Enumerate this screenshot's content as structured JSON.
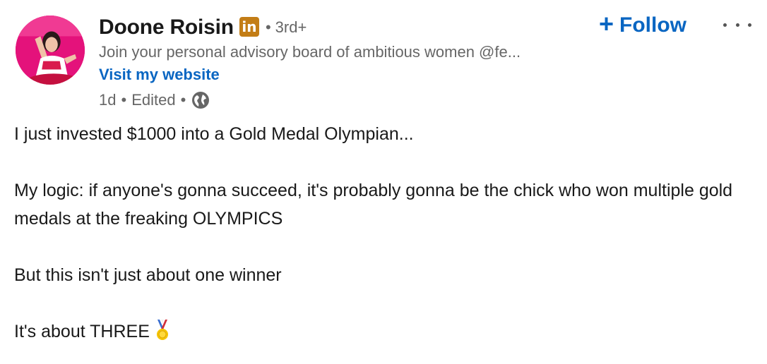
{
  "author": {
    "name": "Doone Roisin",
    "badge": "in",
    "separator": "•",
    "degree": "3rd+",
    "headline": "Join your personal advisory board of ambitious women @fe...",
    "website_link": "Visit my website",
    "time": "1d",
    "edited": "Edited",
    "visibility_icon": "globe-icon"
  },
  "actions": {
    "follow_plus": "+",
    "follow_label": "Follow",
    "more_icon": "more-dots-icon"
  },
  "post": {
    "lines": [
      "I just invested $1000 into a Gold Medal Olympian...",
      "My logic: if anyone's gonna succeed, it's probably gonna be the chick who won multiple gold medals at the freaking OLYMPICS",
      "But this isn't just about one winner",
      "It's about THREE"
    ],
    "emoji_icon": "gold-medal-icon"
  },
  "colors": {
    "link_blue": "#0a66c2",
    "badge_gold": "#c37d16",
    "secondary_text": "#666666",
    "primary_text": "#191919"
  }
}
